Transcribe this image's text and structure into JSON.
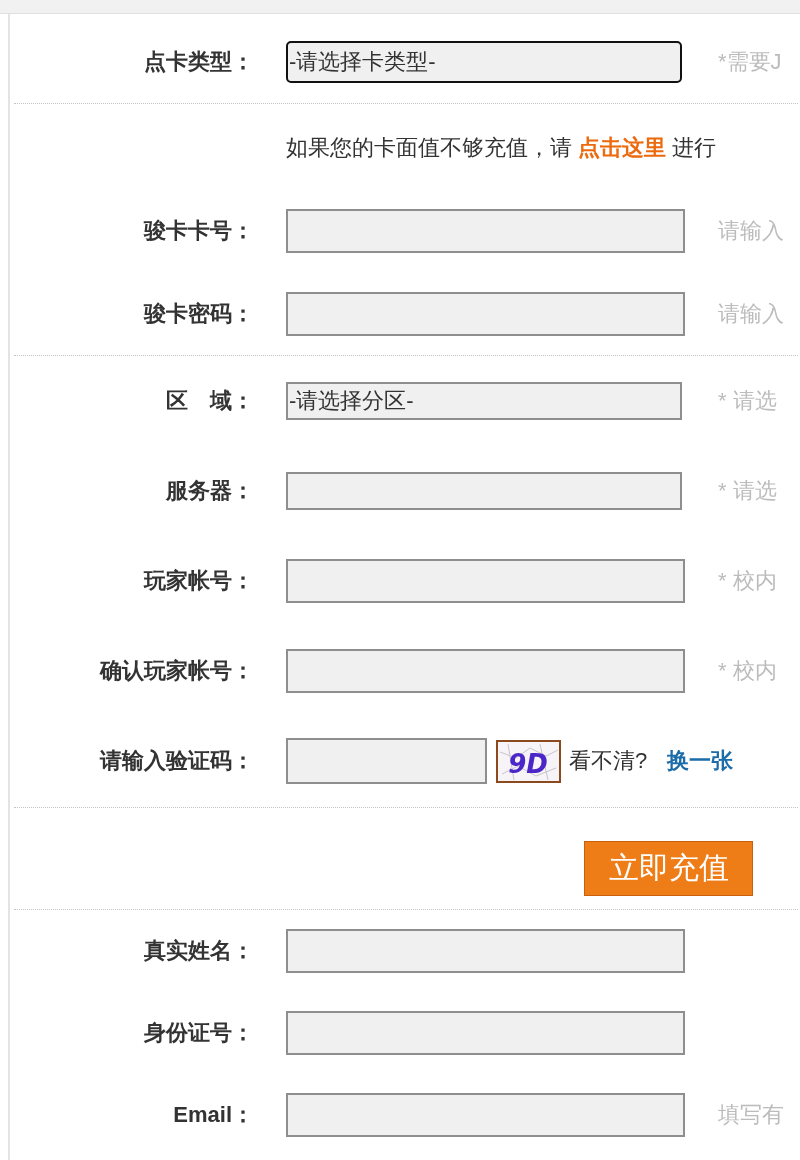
{
  "sections": [
    {
      "rows": [
        {
          "kind": "select",
          "label": "点卡类型：",
          "value": "-请选择卡类型-",
          "focused": true,
          "hint": "*需要J"
        }
      ]
    },
    {
      "rows": [
        {
          "kind": "note",
          "text": "如果您的卡面值不够充值，请",
          "link": "点击这里",
          "after": "进行"
        },
        {
          "kind": "input",
          "label": "骏卡卡号：",
          "focused": false,
          "hint": "请输入"
        },
        {
          "kind": "input",
          "label": "骏卡密码：",
          "focused": false,
          "hint": "请输入"
        }
      ]
    },
    {
      "rows": [
        {
          "kind": "select",
          "label": "区　域：",
          "value": "-请选择分区-",
          "focused": false,
          "hint": "* 请选"
        },
        {
          "kind": "select",
          "label": "服务器：",
          "focused": false,
          "hint": "* 请选"
        },
        {
          "kind": "input",
          "label": "玩家帐号：",
          "focused": false,
          "hint": "* 校内"
        },
        {
          "kind": "input",
          "label": "确认玩家帐号：",
          "focused": false,
          "hint": "* 校内"
        },
        {
          "kind": "captcha",
          "label": "请输入验证码：",
          "focused": false,
          "code": "9D",
          "prompt": "看不清?",
          "link": "换一张"
        }
      ]
    },
    {
      "rows": [
        {
          "kind": "button",
          "label": "立即充值"
        }
      ]
    },
    {
      "rows": [
        {
          "kind": "input",
          "label": "真实姓名：",
          "focused": false
        },
        {
          "kind": "input",
          "label": "身份证号：",
          "focused": false
        },
        {
          "kind": "input",
          "label": "Email：",
          "focused": false,
          "hint": "填写有"
        }
      ]
    }
  ]
}
